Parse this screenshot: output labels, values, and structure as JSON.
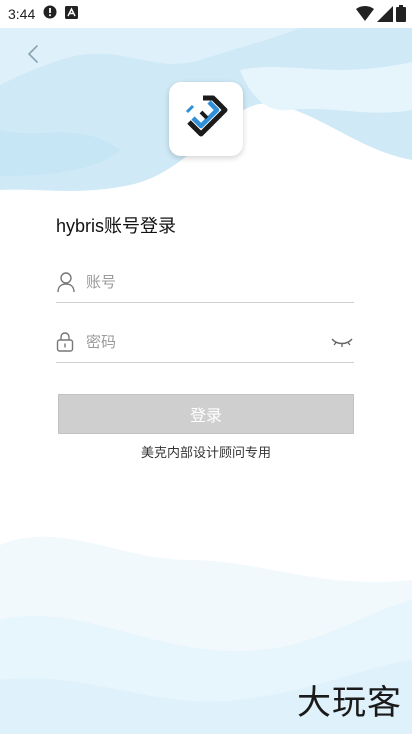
{
  "status_bar": {
    "time": "3:44",
    "icons": [
      "alert-icon",
      "a-icon",
      "wifi-icon",
      "signal-icon",
      "battery-icon"
    ]
  },
  "nav": {
    "back_icon": "chevron-left-icon"
  },
  "app": {
    "logo_icon": "hybris-logo"
  },
  "login": {
    "title": "hybris账号登录",
    "account_placeholder": "账号",
    "account_value": "",
    "password_placeholder": "密码",
    "password_value": "",
    "submit_label": "登录",
    "note": "美克内部设计顾问专用"
  },
  "watermark": "大玩客",
  "colors": {
    "bg_blue": "#cfe9f7",
    "bg_light": "#eef8fd",
    "button_disabled": "#cfcfcf",
    "logo_blue": "#2f8fd8",
    "logo_dark": "#1b1b1b"
  }
}
